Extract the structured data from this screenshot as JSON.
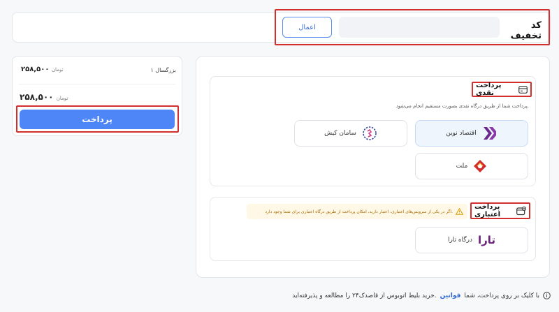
{
  "discount": {
    "title": "کد تخفیف",
    "input_value": "",
    "apply_label": "اعمال"
  },
  "summary": {
    "passenger_label": "۱ بزرگسال",
    "line_price": "۲۵۸,۵۰۰",
    "currency": "تومان",
    "total_price": "۲۵۸,۵۰۰",
    "pay_label": "پرداخت"
  },
  "payment": {
    "cash": {
      "title": "پرداخت نقدی",
      "description": "پرداخت شما از طریق درگاه نقدی بصورت مستقیم انجام می‌شود.",
      "gateways": [
        {
          "label": "اقتصاد نوین",
          "icon": "eghtesad-novin-logo",
          "selected": true
        },
        {
          "label": "سامان کیش",
          "icon": "saman-kish-logo",
          "selected": false
        },
        {
          "label": "ملت",
          "icon": "mellat-logo",
          "selected": false
        }
      ]
    },
    "credit": {
      "title": "پرداخت اعتباری",
      "warning": "اگر در یکی از سرویس‌های اعتباری، اعتبار دارید، امکان پرداخت از طریق درگاه اعتباری برای شما وجود دارد.",
      "gateways": [
        {
          "label": "درگاه تارا",
          "icon": "tara-logo",
          "logo_text": "تارا"
        }
      ]
    }
  },
  "footer": {
    "before_link": "با کلیک بر روی پرداخت، شما",
    "link": "قوانین",
    "after_link": "خرید بلیط اتوبوس از قاصدک۲۴ را مطالعه و پذیرفته‌اید."
  },
  "colors": {
    "primary": "#4f86f7",
    "highlight": "#d32f2f",
    "warning_bg": "#fff8e6",
    "warning_text": "#a86a00",
    "eghtesad": "#6a2a8c",
    "mellat": "#d22b2b",
    "tara": "#6b1f7a"
  }
}
